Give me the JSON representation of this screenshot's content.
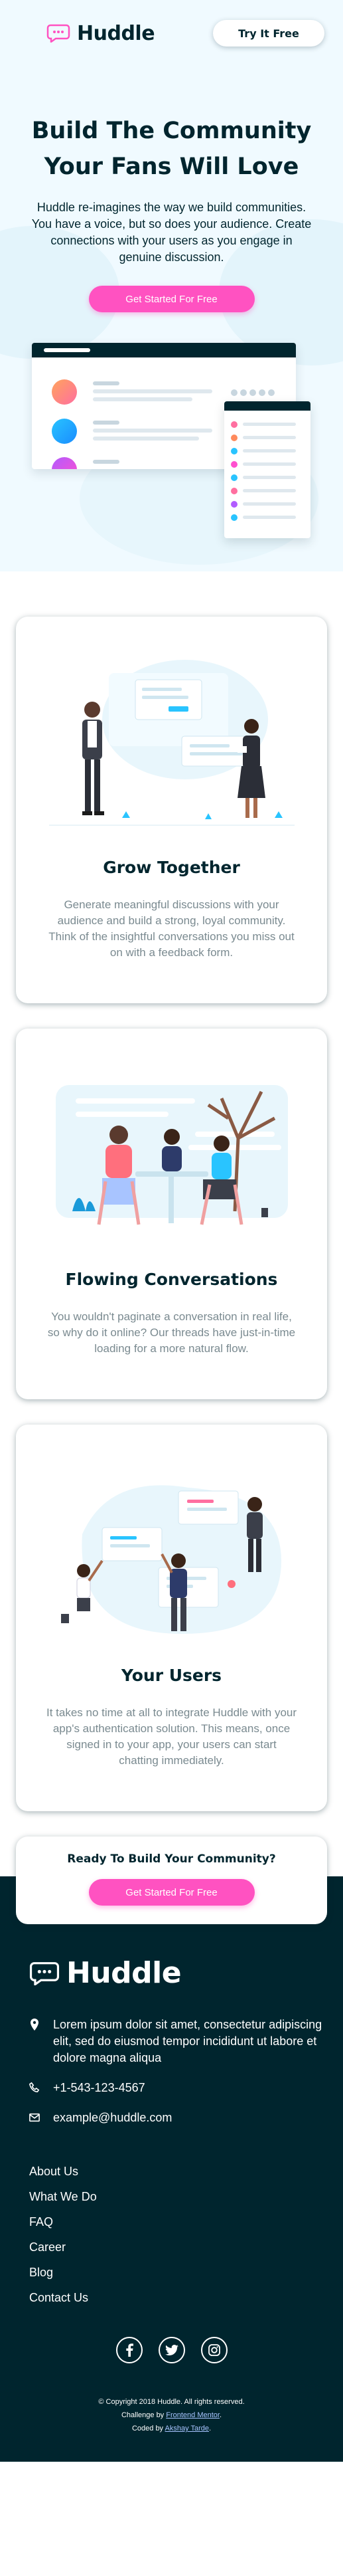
{
  "header": {
    "logo_text": "Huddle",
    "try_button": "Try It Free"
  },
  "hero": {
    "title_line1": "Build The Community",
    "title_line2": "Your Fans Will Love",
    "text": "Huddle re-imagines the way we build communities. You have a voice, but so does your audience. Create connections with your users as you engage in genuine discussion.",
    "cta": "Get Started For Free"
  },
  "features": [
    {
      "title": "Grow Together",
      "text": "Generate meaningful discussions with your audience and build a strong, loyal community. Think of the insightful conversations you miss out on with a feedback form."
    },
    {
      "title": "Flowing Conversations",
      "text": "You wouldn't paginate a conversation in real life, so why do it online? Our threads have just-in-time loading for a more natural flow."
    },
    {
      "title": "Your Users",
      "text": "It takes no time at all to integrate Huddle with your app's authentication solution. This means, once signed in to your app, your users can start chatting immediately."
    }
  ],
  "ready": {
    "title": "Ready To Build Your Community?",
    "cta": "Get Started For Free"
  },
  "footer": {
    "logo_text": "Huddle",
    "address": "Lorem ipsum dolor sit amet, consectetur adipiscing elit, sed do eiusmod tempor incididunt ut labore et dolore magna aliqua",
    "phone": "+1-543-123-4567",
    "email": "example@huddle.com",
    "links": [
      "About Us",
      "What We Do",
      "FAQ",
      "Career",
      "Blog",
      "Contact Us"
    ],
    "copyright": "© Copyright 2018 Huddle. All rights reserved.",
    "challenge_prefix": "Challenge by",
    "challenge_link": "Frontend Mentor",
    "coded_prefix": "Coded by",
    "coded_link": "Akshay Tarde"
  },
  "colors": {
    "brand_pink": "#ff52c1",
    "dark_cyan": "#00252e",
    "hero_bg": "#f0faff",
    "gray_text": "#7a8a90"
  },
  "icons": [
    "chat-bubble-icon",
    "location-pin-icon",
    "phone-icon",
    "mail-icon",
    "facebook-icon",
    "twitter-icon",
    "instagram-icon"
  ]
}
